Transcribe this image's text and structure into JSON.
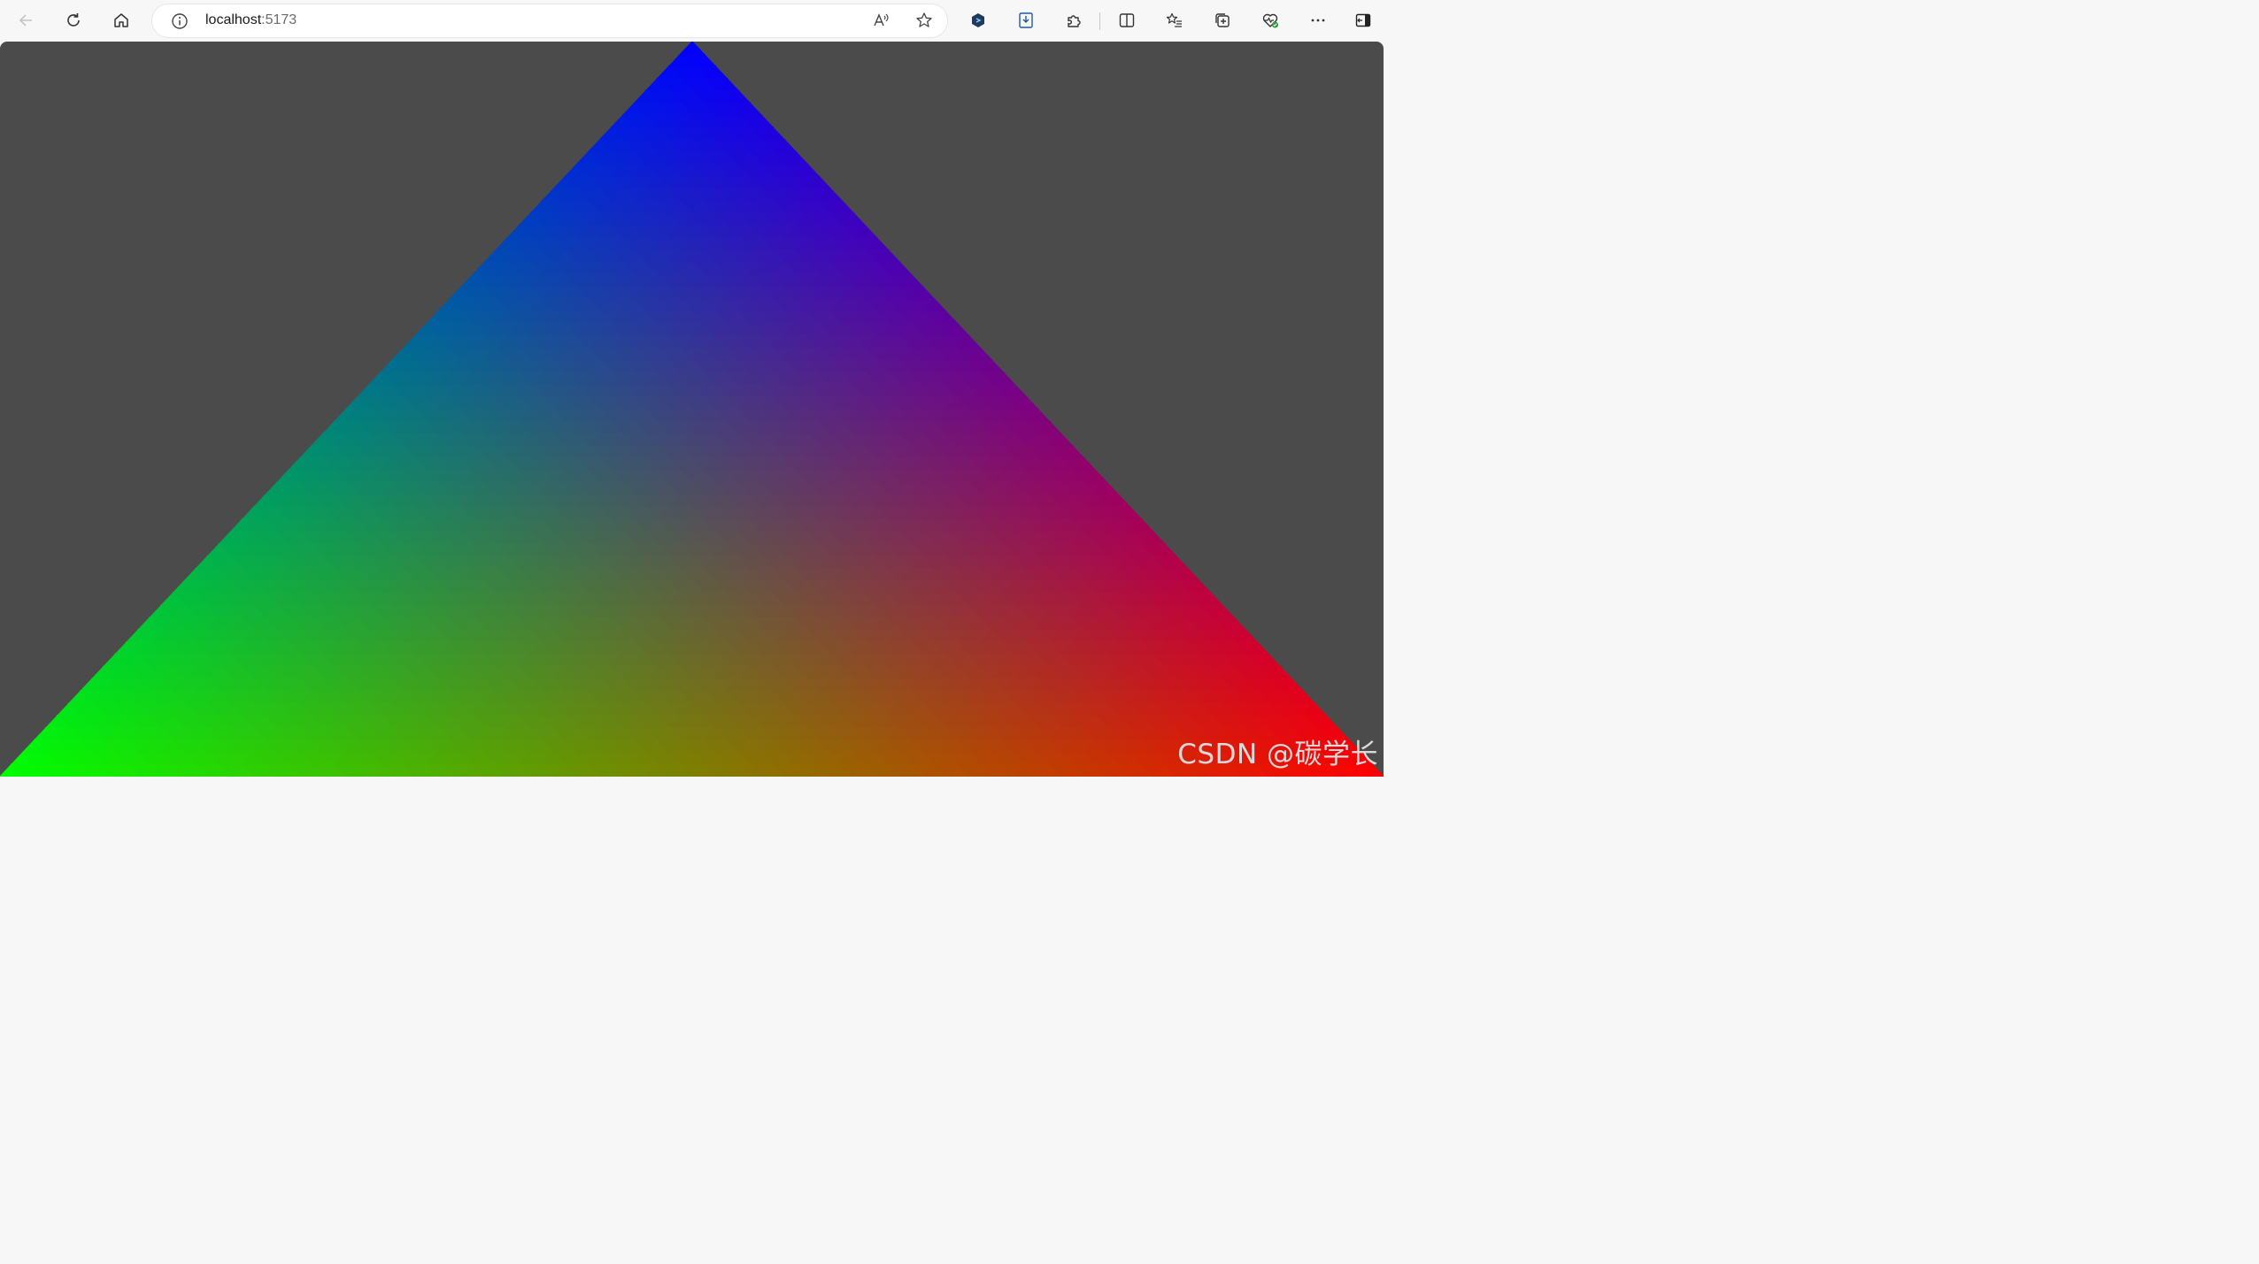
{
  "browser": {
    "address_bar": {
      "host": "localhost",
      "port": ":5173"
    },
    "icons": {
      "back": "arrow-left-icon",
      "reload": "reload-icon",
      "home": "home-icon",
      "site_info": "info-icon",
      "read_aloud": "read-aloud-icon",
      "favorite": "star-icon",
      "extension_1": "hexagon-extension-icon",
      "extension_2": "download-extension-icon",
      "extensions": "puzzle-icon",
      "split_screen": "split-screen-icon",
      "favorites": "favorites-list-icon",
      "collections": "collections-icon",
      "performance": "heart-pulse-icon",
      "more": "more-icon",
      "sidebar": "sidebar-icon"
    }
  },
  "canvas": {
    "background_color": "#4b4b4b",
    "triangle": {
      "top_vertex_color": "#0000ff",
      "left_vertex_color": "#00ff00",
      "right_vertex_color": "#ff0000"
    }
  },
  "watermark": "CSDN @碳学长"
}
